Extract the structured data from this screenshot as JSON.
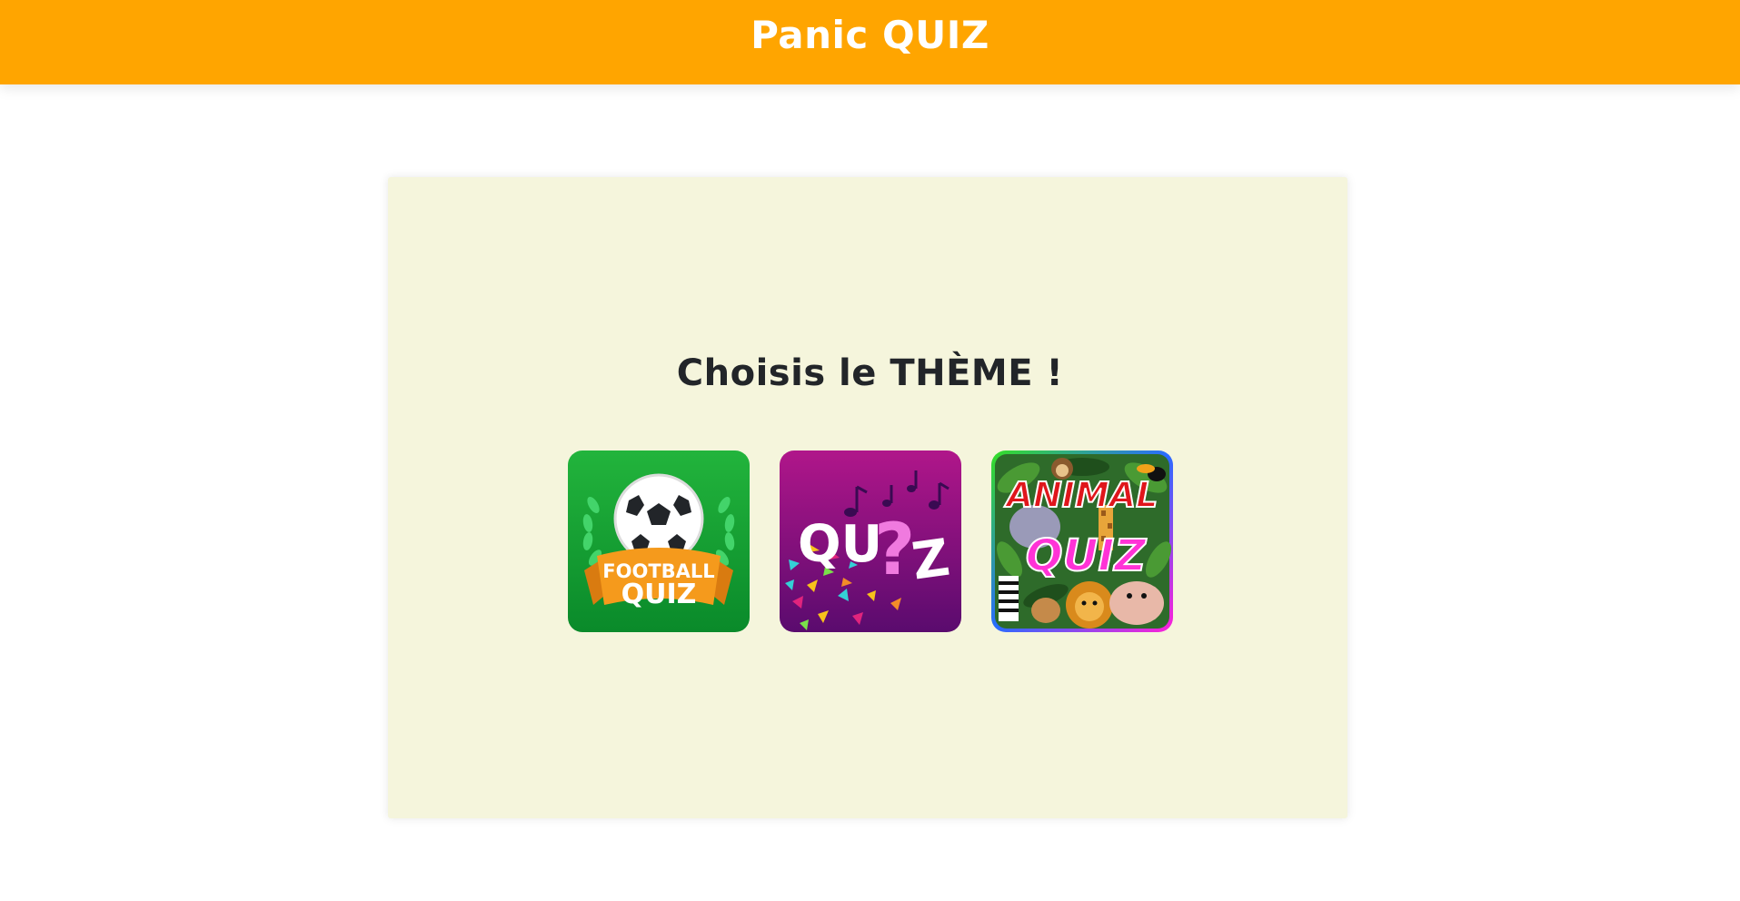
{
  "header": {
    "title": "Panic QUIZ",
    "color": "#FFA500"
  },
  "main": {
    "heading": "Choisis le THÈME !",
    "panel_color": "#F5F5DC",
    "themes": [
      {
        "id": "football",
        "icon": "football-quiz-icon",
        "line1": "FOOTBALL",
        "line2": "QUIZ",
        "colors": {
          "bg_top": "#22B43C",
          "bg_bottom": "#0A8A2A",
          "ribbon": "#F59A1C"
        }
      },
      {
        "id": "music",
        "icon": "music-quiz-icon",
        "line1": "QU",
        "line2": "?",
        "line3": "Z",
        "colors": {
          "bg_top": "#B0168A",
          "bg_bottom": "#5A0B6E",
          "accent": "#F07ADF"
        }
      },
      {
        "id": "animal",
        "icon": "animal-quiz-icon",
        "line1": "ANIMAL",
        "line2": "QUIZ",
        "colors": {
          "jungle": "#2E6B2A",
          "title": "#E0161C",
          "quiz": "#FF33D6"
        }
      }
    ]
  }
}
